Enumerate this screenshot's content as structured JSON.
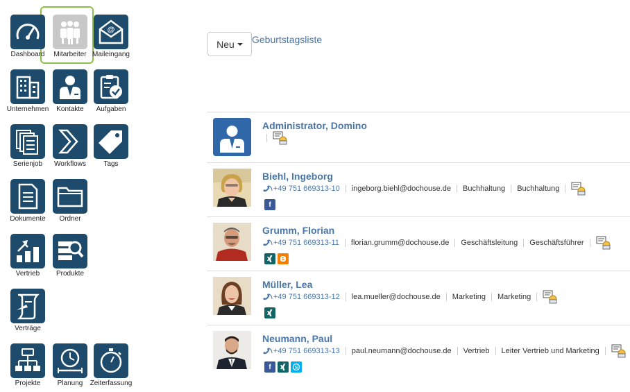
{
  "nav": {
    "dashboard": "Dashboard",
    "mitarbeiter": "Mitarbeiter",
    "maileingang": "Maileingang",
    "unternehmen": "Unternehmen",
    "kontakte": "Kontakte",
    "aufgaben": "Aufgaben",
    "serienjob": "Serienjob",
    "workflows": "Workflows",
    "tags": "Tags",
    "dokumente": "Dokumente",
    "ordner": "Ordner",
    "vertrieb": "Vertrieb",
    "produkte": "Produkte",
    "vertraege": "Verträge",
    "projekte": "Projekte",
    "planung": "Planung",
    "zeiterfassung": "Zeiterfassung",
    "active": "mitarbeiter"
  },
  "toolbar": {
    "new_label": "Neu",
    "birthday_link": "Geburtstagsliste"
  },
  "employees": [
    {
      "name": "Administrator, Domino",
      "phone": "",
      "email": "",
      "department": "",
      "position": "",
      "social": []
    },
    {
      "name": "Biehl, Ingeborg",
      "phone": "+49 751 669313-10",
      "email": "ingeborg.biehl@dochouse.de",
      "department": "Buchhaltung",
      "position": "Buchhaltung",
      "social": [
        "facebook"
      ]
    },
    {
      "name": "Grumm, Florian",
      "phone": "+49 751 669313-11",
      "email": "florian.grumm@dochouse.de",
      "department": "Geschäftsleitung",
      "position": "Geschäftsführer",
      "social": [
        "xing",
        "blogger"
      ]
    },
    {
      "name": "Müller, Lea",
      "phone": "+49 751 669313-12",
      "email": "lea.mueller@dochouse.de",
      "department": "Marketing",
      "position": "Marketing",
      "social": [
        "xing"
      ]
    },
    {
      "name": "Neumann, Paul",
      "phone": "+49 751 669313-13",
      "email": "paul.neumann@dochouse.de",
      "department": "Vertrieb",
      "position": "Leiter Vertrieb und Marketing",
      "social": [
        "facebook",
        "xing",
        "skype"
      ]
    }
  ],
  "colors": {
    "tile": "#1e4a6b",
    "tile_active": "#c8c8c8",
    "selection": "#8cc04b",
    "link": "#4a77a8",
    "facebook": "#3b5998",
    "xing": "#126567",
    "blogger": "#f57d00",
    "skype": "#00aff0"
  }
}
